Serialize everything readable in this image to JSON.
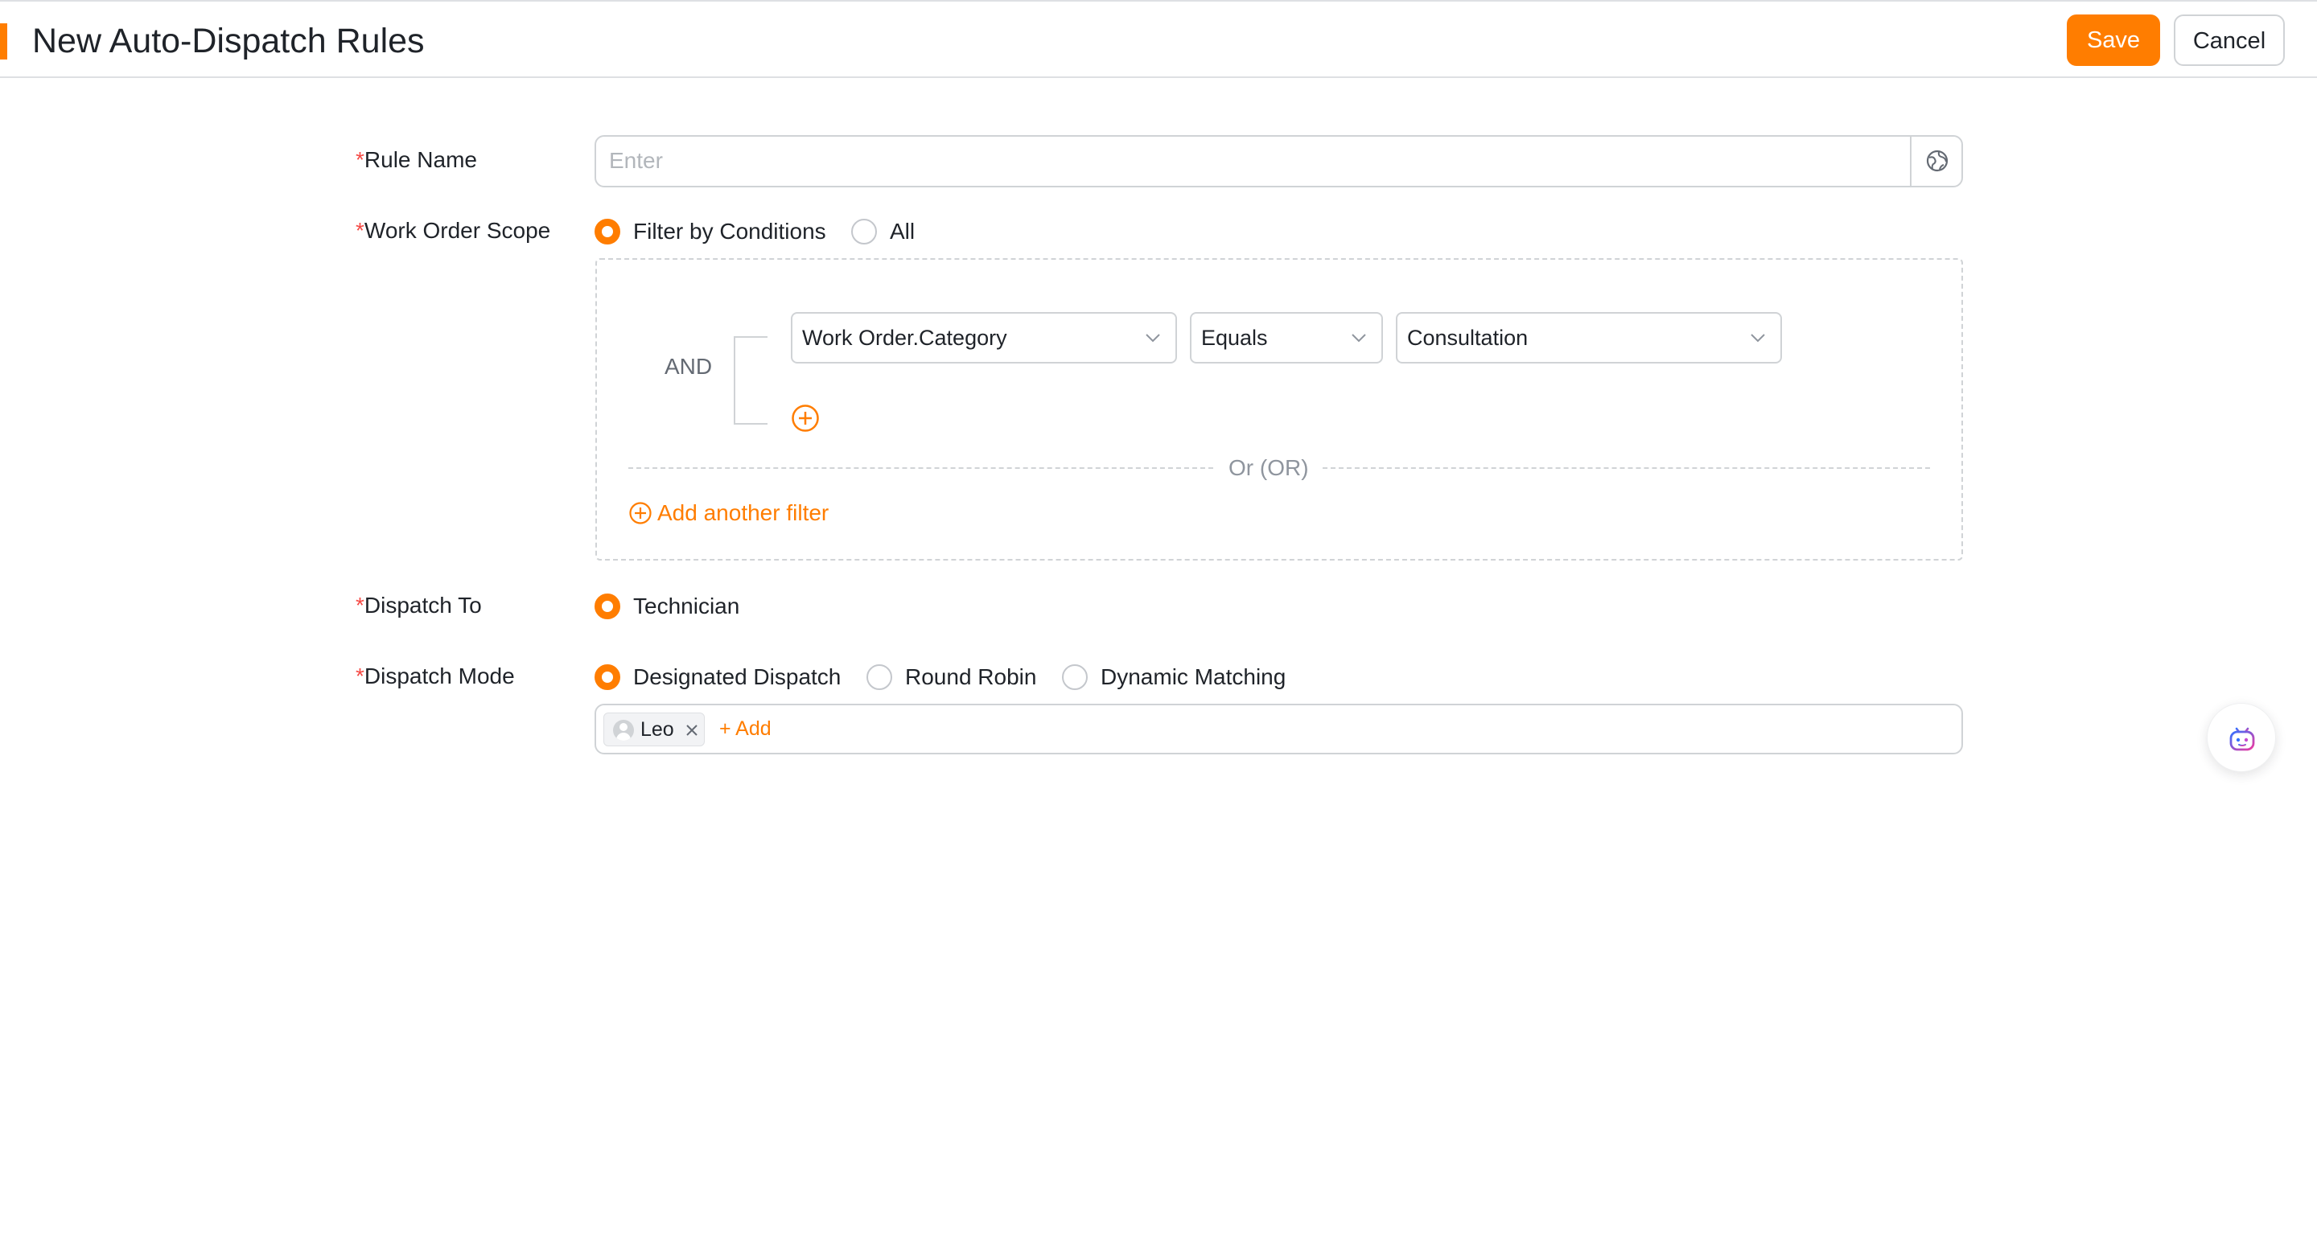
{
  "header": {
    "title": "New Auto-Dispatch Rules",
    "save_label": "Save",
    "cancel_label": "Cancel",
    "accent_color": "#ff7d00"
  },
  "form": {
    "required_mark": "*",
    "rule_name": {
      "label": "Rule Name",
      "value": "",
      "placeholder": "Enter",
      "suffix_icon": "globe-icon"
    },
    "work_order_scope": {
      "label": "Work Order Scope",
      "options": [
        {
          "label": "Filter by Conditions",
          "selected": true
        },
        {
          "label": "All",
          "selected": false
        }
      ],
      "filter": {
        "logic_label": "AND",
        "conditions": [
          {
            "field": "Work Order.Category",
            "operator": "Equals",
            "value": "Consultation"
          }
        ],
        "or_separator": "Or (OR)",
        "add_filter_label": "Add another filter"
      }
    },
    "dispatch_to": {
      "label": "Dispatch To",
      "options": [
        {
          "label": "Technician",
          "selected": true
        }
      ]
    },
    "dispatch_mode": {
      "label": "Dispatch Mode",
      "options": [
        {
          "label": "Designated Dispatch",
          "selected": true
        },
        {
          "label": "Round Robin",
          "selected": false
        },
        {
          "label": "Dynamic Matching",
          "selected": false
        }
      ],
      "assignees": [
        {
          "name": "Leo"
        }
      ],
      "add_label": "+ Add"
    }
  },
  "floating_assistant": {
    "icon": "robot-assistant-icon"
  }
}
